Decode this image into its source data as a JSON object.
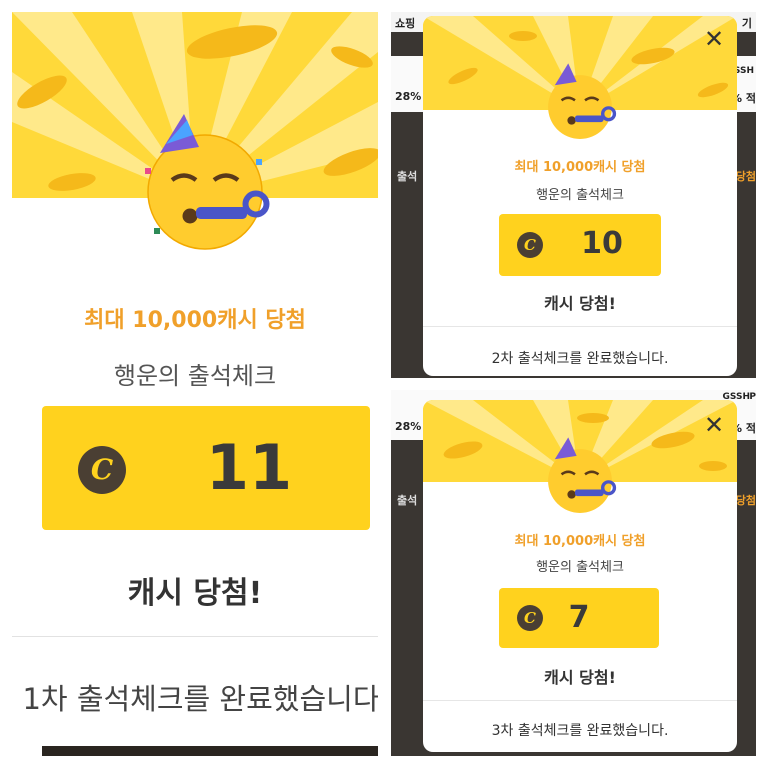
{
  "colors": {
    "hero_yellow": "#ffd93a",
    "cash_box": "#ffd21e",
    "max_text": "#f0a02a",
    "coin_dark": "#4a3f33"
  },
  "icons": {
    "emoji": "partying-face-icon",
    "coin": "cash-coin-icon",
    "close": "close-icon"
  },
  "background_app": {
    "top_left_text": "쇼핑",
    "top_right_text": "기",
    "left_percent": "28%",
    "right_percent": "% 적",
    "left_side_text": "출석",
    "right_side_text": "당첨",
    "gssh_label": "GSSH",
    "p_label": "P"
  },
  "panels": [
    {
      "max_text": "최대 10,000캐시 당첨",
      "subtitle": "행운의 출석체크",
      "coin_symbol": "C",
      "amount": "11",
      "win_text": "캐시 당첨!",
      "done_text": "1차 출석체크를 완료했습니다"
    },
    {
      "max_text": "최대 10,000캐시 당첨",
      "subtitle": "행운의 출석체크",
      "coin_symbol": "C",
      "amount": "10",
      "win_text": "캐시 당첨!",
      "done_text": "2차 출석체크를 완료했습니다.",
      "close_symbol": "✕"
    },
    {
      "max_text": "최대 10,000캐시 당첨",
      "subtitle": "행운의 출석체크",
      "coin_symbol": "C",
      "amount": "7",
      "win_text": "캐시 당첨!",
      "done_text": "3차 출석체크를 완료했습니다.",
      "close_symbol": "✕"
    }
  ]
}
